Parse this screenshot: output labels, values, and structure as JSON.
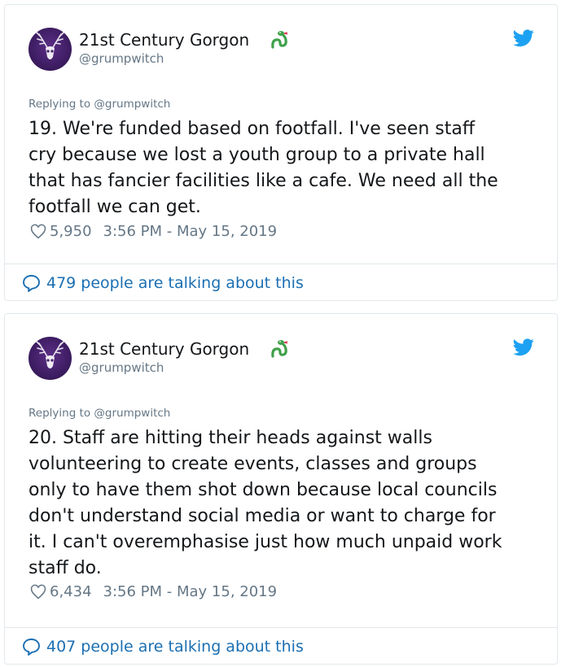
{
  "tweets": [
    {
      "display_name": "21st Century Gorgon",
      "handle": "@grumpwitch",
      "replying_to": "Replying to @grumpwitch",
      "text": "19. We're funded based on footfall. I've seen staff\ncry because we lost a youth group to a private hall\nthat has fancier facilities like a cafe. We need all the\nfootfall we can get.",
      "likes": "5,950",
      "timestamp": "3:56 PM - May 15, 2019",
      "talking": "479 people are talking about this"
    },
    {
      "display_name": "21st Century Gorgon",
      "handle": "@grumpwitch",
      "replying_to": "Replying to @grumpwitch",
      "text": "20. Staff are hitting their heads against walls\nvolunteering to create events, classes and groups\nonly to have them shot down because local councils\ndon't understand social media or want to charge for\nit. I can't overemphasise just how much unpaid work\nstaff do.",
      "likes": "6,434",
      "timestamp": "3:56 PM - May 15, 2019",
      "talking": "407 people are talking about this"
    }
  ],
  "icons": {
    "avatar": "stag-skull-avatar",
    "emoji": "snake-emoji-icon",
    "brand": "twitter-bird-icon",
    "like": "heart-icon",
    "reply": "speech-bubble-icon"
  },
  "colors": {
    "link_blue": "#1b6fb3",
    "twitter_blue": "#1da1f2",
    "muted_gray": "#657786",
    "border": "#e1e8ed",
    "avatar_purple": "#3e1d63",
    "snake_green": "#3fa14a"
  }
}
